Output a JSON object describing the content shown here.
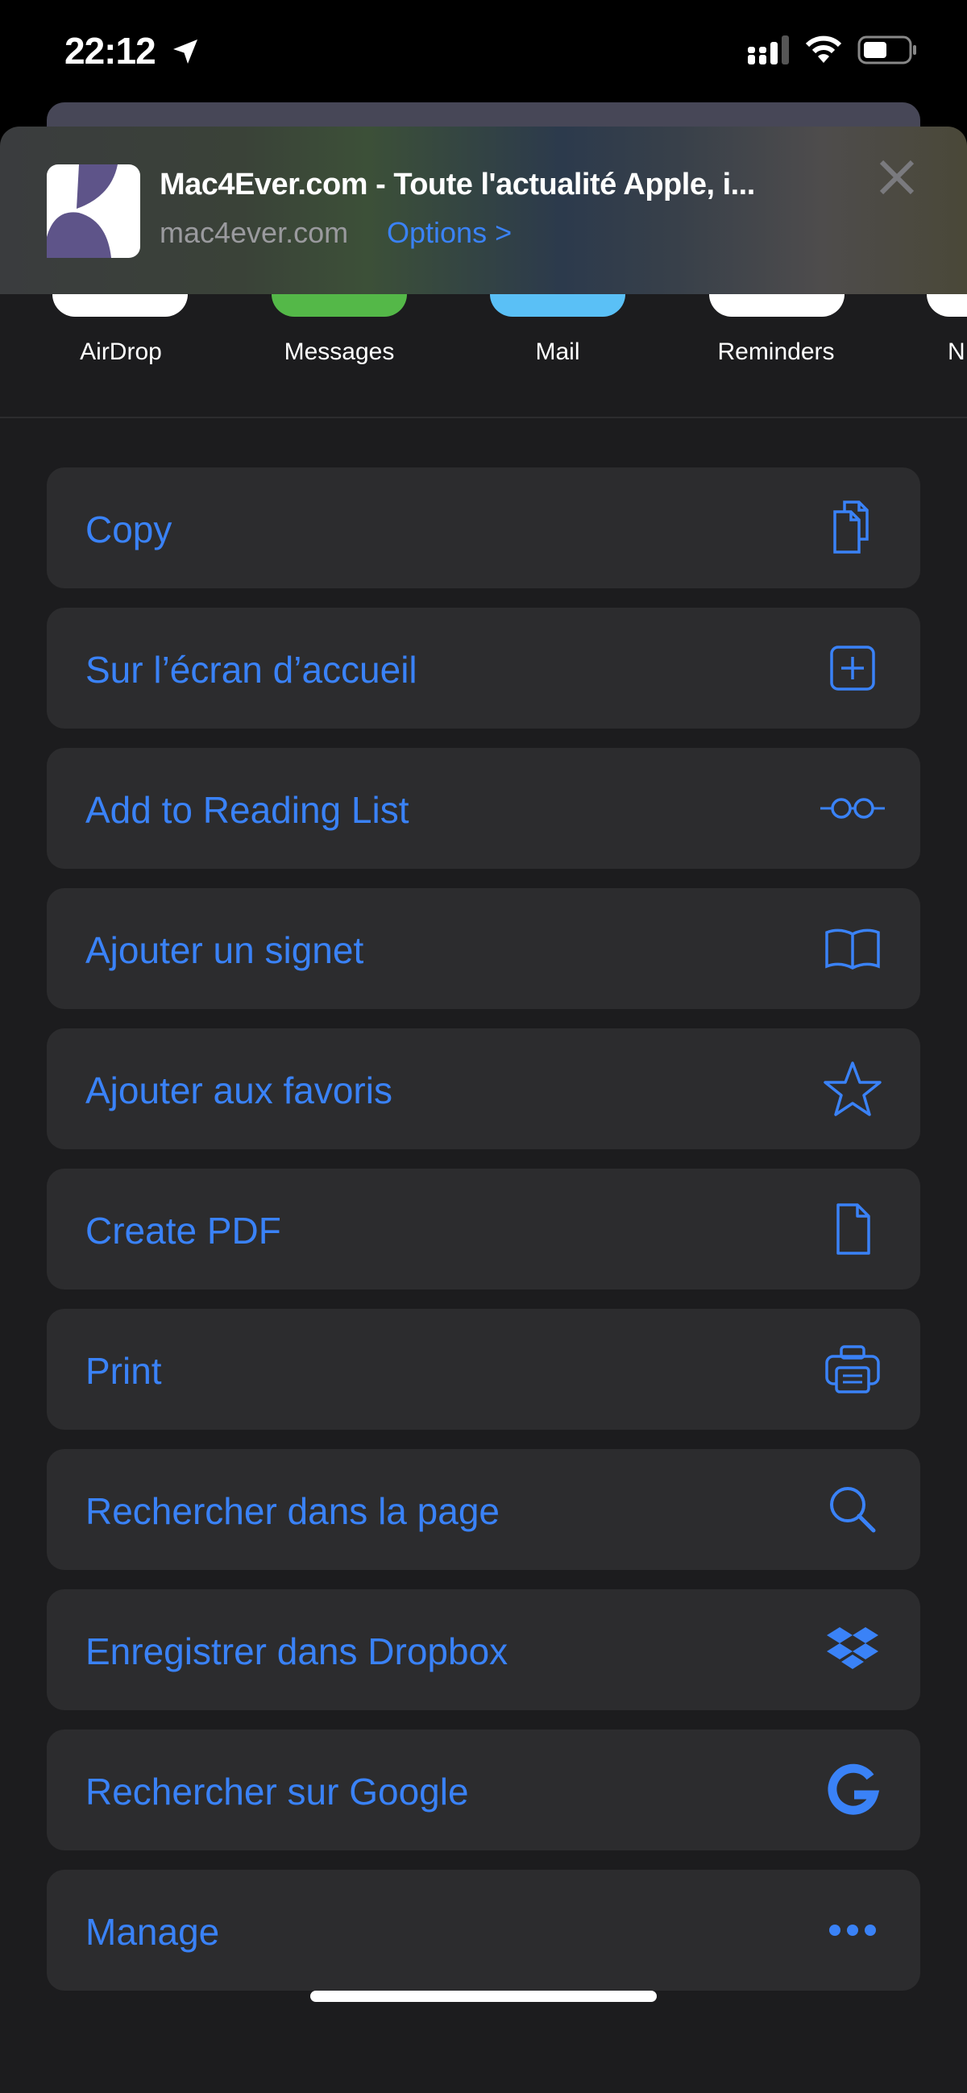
{
  "status_bar": {
    "time": "22:12",
    "icons": [
      "location-arrow-icon",
      "cellular-signal-icon",
      "wifi-icon",
      "battery-icon"
    ]
  },
  "header": {
    "title": "Mac4Ever.com - Toute l'actualité Apple, i...",
    "domain": "mac4ever.com",
    "options_label": "Options >",
    "favicon_colors": [
      "#5e5489",
      "#ffffff"
    ]
  },
  "apps": [
    {
      "label": "AirDrop",
      "color": "#ffffff"
    },
    {
      "label": "Messages",
      "color": "#54b848"
    },
    {
      "label": "Mail",
      "color": "#5ac0f6"
    },
    {
      "label": "Reminders",
      "color": "#ffffff"
    },
    {
      "label": "N",
      "color": "#ffffff"
    }
  ],
  "actions": [
    {
      "label": "Copy",
      "icon": "copy-icon"
    },
    {
      "label": "Sur l’écran d’accueil",
      "icon": "add-square-icon"
    },
    {
      "label": "Add to Reading List",
      "icon": "glasses-icon"
    },
    {
      "label": "Ajouter un signet",
      "icon": "book-icon"
    },
    {
      "label": "Ajouter aux favoris",
      "icon": "star-icon"
    },
    {
      "label": "Create PDF",
      "icon": "document-icon"
    },
    {
      "label": "Print",
      "icon": "printer-icon"
    },
    {
      "label": "Rechercher dans la page",
      "icon": "search-icon"
    },
    {
      "label": "Enregistrer dans Dropbox",
      "icon": "dropbox-icon"
    },
    {
      "label": "Rechercher sur Google",
      "icon": "google-icon"
    },
    {
      "label": "Manage",
      "icon": "ellipsis-icon"
    }
  ],
  "colors": {
    "accent": "#3a82f7",
    "background": "#1c1c1e",
    "row": "#2c2c2e"
  }
}
